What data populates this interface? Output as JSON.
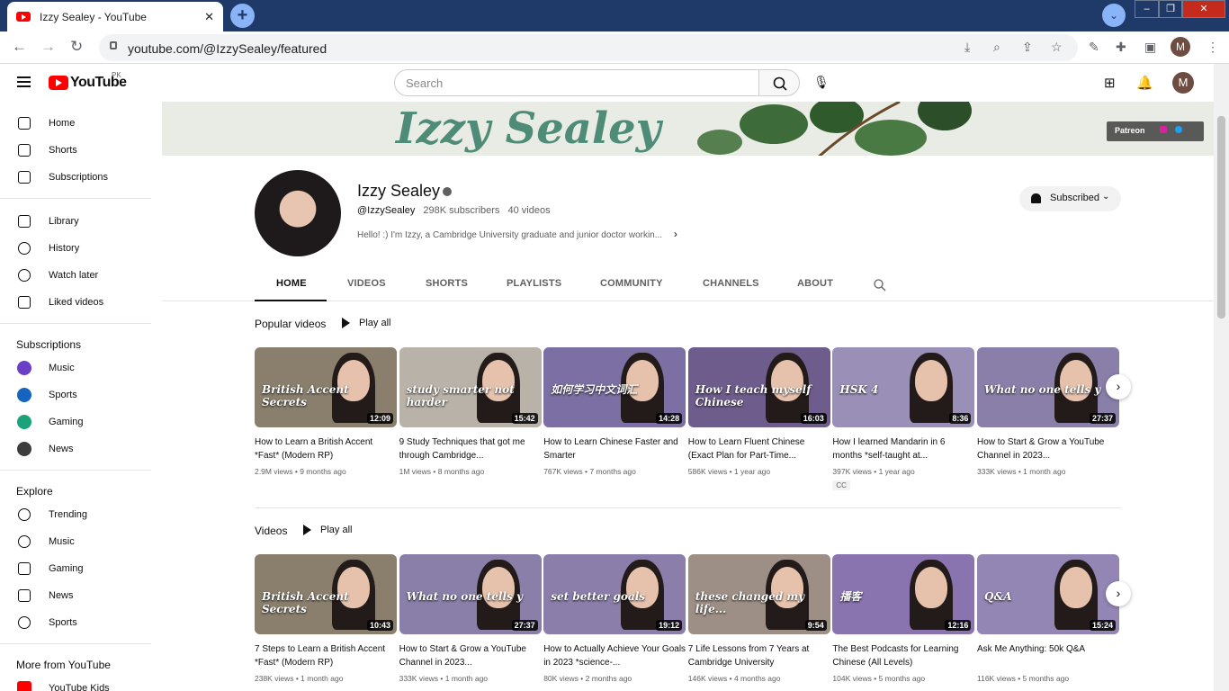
{
  "browser": {
    "tab_title": "Izzy Sealey - YouTube",
    "tab_close": "✕",
    "new_tab": "+",
    "url": "youtube.com/@IzzySealey/featured",
    "profile_initial": "M",
    "window_controls": [
      "–",
      "❐",
      "✕"
    ]
  },
  "youtube": {
    "logo_text": "YouTube",
    "country_code": "PK",
    "search_placeholder": "Search",
    "avatar_initial": "M"
  },
  "sidebar": {
    "primary": [
      {
        "label": "Home",
        "icon": "home-icon"
      },
      {
        "label": "Shorts",
        "icon": "shorts-icon"
      },
      {
        "label": "Subscriptions",
        "icon": "subscriptions-icon"
      }
    ],
    "library": [
      {
        "label": "Library",
        "icon": "library-icon"
      },
      {
        "label": "History",
        "icon": "history-icon"
      },
      {
        "label": "Watch later",
        "icon": "watch-later-icon"
      },
      {
        "label": "Liked videos",
        "icon": "liked-icon"
      }
    ],
    "subscriptions_heading": "Subscriptions",
    "subscriptions": [
      {
        "label": "Music",
        "color": "#6a3fc7"
      },
      {
        "label": "Sports",
        "color": "#1565c0"
      },
      {
        "label": "Gaming",
        "color": "#1aa37a"
      },
      {
        "label": "News",
        "color": "#3c3c3c"
      }
    ],
    "explore_heading": "Explore",
    "explore": [
      {
        "label": "Trending",
        "icon": "trending-icon"
      },
      {
        "label": "Music",
        "icon": "music-icon"
      },
      {
        "label": "Gaming",
        "icon": "gaming-icon"
      },
      {
        "label": "News",
        "icon": "news-icon"
      },
      {
        "label": "Sports",
        "icon": "sports-icon"
      }
    ],
    "more_heading": "More from YouTube",
    "more": [
      {
        "label": "YouTube Kids"
      }
    ]
  },
  "banner": {
    "title": "Izzy Sealey",
    "patreon": "Patreon"
  },
  "channel": {
    "name": "Izzy Sealey",
    "handle": "@IzzySealey",
    "subscribers": "298K subscribers",
    "videos": "40 videos",
    "description": "Hello! :) I'm Izzy, a Cambridge University graduate and junior doctor workin...",
    "subscribe_label": "Subscribed"
  },
  "tabs": [
    "HOME",
    "VIDEOS",
    "SHORTS",
    "PLAYLISTS",
    "COMMUNITY",
    "CHANNELS",
    "ABOUT"
  ],
  "sections": {
    "popular": {
      "title": "Popular videos",
      "play_all": "Play all",
      "videos": [
        {
          "title": "How to Learn a British Accent *Fast* (Modern RP)",
          "views": "2.9M views",
          "age": "9 months ago",
          "duration": "12:09",
          "overlay": "British Accent Secrets",
          "bg": "#8a7f6d"
        },
        {
          "title": "9 Study Techniques that got me through Cambridge...",
          "views": "1M views",
          "age": "8 months ago",
          "duration": "15:42",
          "overlay": "study smarter not harder",
          "bg": "#b9b2a8"
        },
        {
          "title": "How to Learn Chinese Faster and Smarter",
          "views": "767K views",
          "age": "7 months ago",
          "duration": "14:28",
          "overlay": "如何学习中文词汇",
          "bg": "#7b6fa3"
        },
        {
          "title": "How to Learn Fluent Chinese (Exact Plan for Part-Time...",
          "views": "586K views",
          "age": "1 year ago",
          "duration": "16:03",
          "overlay": "How I teach myself Chinese",
          "bg": "#6e5d8c"
        },
        {
          "title": "How I learned Mandarin in 6 months *self-taught at...",
          "views": "397K views",
          "age": "1 year ago",
          "duration": "8:36",
          "overlay": "HSK 4",
          "bg": "#9a8fb6",
          "badge": "CC"
        },
        {
          "title": "How to Start & Grow a YouTube Channel in 2023...",
          "views": "333K views",
          "age": "1 month ago",
          "duration": "27:37",
          "overlay": "What no one tells y",
          "bg": "#8a7fa8"
        }
      ]
    },
    "videos": {
      "title": "Videos",
      "play_all": "Play all",
      "videos": [
        {
          "title": "7 Steps to Learn a British Accent *Fast* (Modern RP)",
          "views": "238K views",
          "age": "1 month ago",
          "duration": "10:43",
          "overlay": "British Accent Secrets",
          "bg": "#8a7f6d"
        },
        {
          "title": "How to Start & Grow a YouTube Channel in 2023...",
          "views": "333K views",
          "age": "1 month ago",
          "duration": "27:37",
          "overlay": "What no one tells y",
          "bg": "#8a7fa8"
        },
        {
          "title": "How to Actually Achieve Your Goals in 2023 *science-...",
          "views": "80K views",
          "age": "2 months ago",
          "duration": "19:12",
          "overlay": "set better goals",
          "bg": "#8b7eaa"
        },
        {
          "title": "7 Life Lessons from 7 Years at Cambridge University",
          "views": "146K views",
          "age": "4 months ago",
          "duration": "9:54",
          "overlay": "these changed my life...",
          "bg": "#9d8f85"
        },
        {
          "title": "The Best Podcasts for Learning Chinese (All Levels)",
          "views": "104K views",
          "age": "5 months ago",
          "duration": "12:16",
          "overlay": "播客",
          "bg": "#8a74b0"
        },
        {
          "title": "Ask Me Anything: 50k Q&A",
          "views": "116K views",
          "age": "5 months ago",
          "duration": "15:24",
          "overlay": "Q&A",
          "bg": "#9486b4"
        }
      ]
    }
  }
}
